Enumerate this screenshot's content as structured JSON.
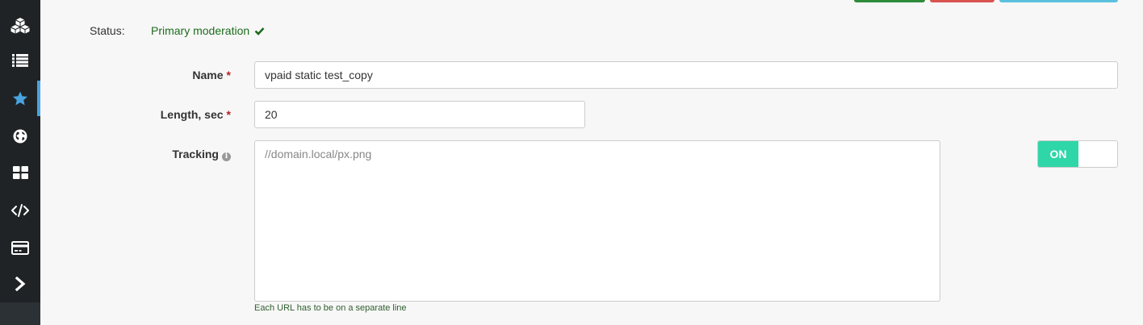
{
  "sidebar": {
    "items": [
      {
        "name": "cubes-icon"
      },
      {
        "name": "list-icon"
      },
      {
        "name": "star-icon",
        "active": true
      },
      {
        "name": "globe-icon"
      },
      {
        "name": "dashboard-icon"
      },
      {
        "name": "code-icon"
      },
      {
        "name": "credit-card-icon"
      },
      {
        "name": "chevron-right-icon"
      }
    ],
    "accent": "#4aa3df"
  },
  "status": {
    "label": "Status:",
    "value": "Primary moderation"
  },
  "form": {
    "name": {
      "label": "Name",
      "required_mark": "*",
      "value": "vpaid static test_copy"
    },
    "length": {
      "label": "Length, sec",
      "required_mark": "*",
      "value": "20"
    },
    "tracking": {
      "label": "Tracking",
      "placeholder": "//domain.local/px.png",
      "help": "Each URL has to be on a separate line",
      "toggle_label": "ON",
      "toggle_color": "#2fd6a8"
    }
  }
}
